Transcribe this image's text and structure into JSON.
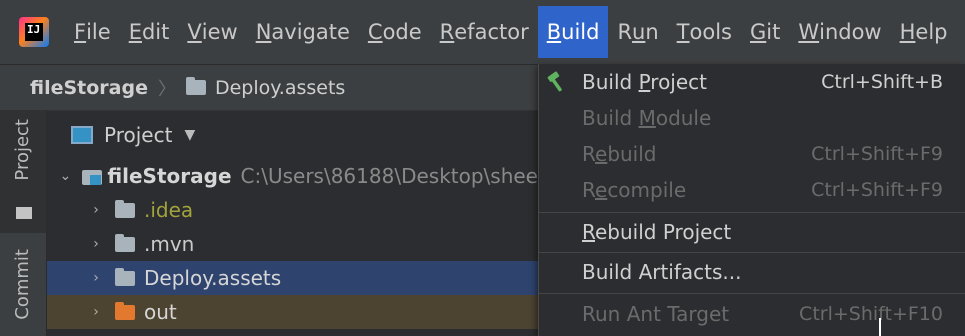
{
  "menubar": {
    "items": [
      {
        "label": "File",
        "underline": "F",
        "rest": "ile"
      },
      {
        "label": "Edit",
        "underline": "E",
        "rest": "dit"
      },
      {
        "label": "View",
        "underline": "V",
        "rest": "iew"
      },
      {
        "label": "Navigate",
        "underline": "N",
        "rest": "avigate"
      },
      {
        "label": "Code",
        "underline": "C",
        "rest": "ode"
      },
      {
        "label": "Refactor",
        "underline": "R",
        "rest": "efactor"
      },
      {
        "label": "Build",
        "underline": "B",
        "rest": "uild"
      },
      {
        "label": "Run",
        "pre": "R",
        "underline": "u",
        "rest": "n"
      },
      {
        "label": "Tools",
        "underline": "T",
        "rest": "ools"
      },
      {
        "label": "Git",
        "underline": "G",
        "rest": "it"
      },
      {
        "label": "Window",
        "underline": "W",
        "rest": "indow"
      },
      {
        "label": "Help",
        "underline": "H",
        "rest": "elp"
      }
    ]
  },
  "navbar": {
    "root": "fileStorage",
    "separator": "〉",
    "crumb": "Deploy.assets"
  },
  "sidestrip": {
    "project_label": "Project",
    "commit_label": "Commit"
  },
  "panel": {
    "header": "Project",
    "root": {
      "name": "fileStorage",
      "path": "C:\\Users\\86188\\Desktop\\shee"
    },
    "rows": [
      {
        "name": ".idea",
        "color": "#a3a33c"
      },
      {
        "name": ".mvn",
        "color": "#c9c9c9"
      },
      {
        "name": "Deploy.assets",
        "color": "#d6d6d6"
      },
      {
        "name": "out",
        "color": "#d6d6d6"
      }
    ]
  },
  "build_menu": {
    "build_project": {
      "pre": "Build ",
      "underline": "P",
      "rest": "roject",
      "shortcut": "Ctrl+Shift+B"
    },
    "build_module": {
      "pre": "Build ",
      "underline": "M",
      "rest": "odule"
    },
    "rebuild": {
      "pre": "R",
      "underline": "e",
      "rest": "build",
      "shortcut": "Ctrl+Shift+F9"
    },
    "recompile": {
      "pre": "R",
      "underline": "e",
      "rest": "compile",
      "shortcut": "Ctrl+Shift+F9"
    },
    "rebuild_project": {
      "underline": "R",
      "rest": "ebuild Project"
    },
    "build_artifacts": {
      "label": "Build Artifacts..."
    },
    "run_ant_target": {
      "label": "Run Ant Target",
      "shortcut": "Ctrl+Shift+F10"
    }
  },
  "colors": {
    "accent": "#2f65ca",
    "selection": "#2e436e",
    "excluded": "#4c4331",
    "hammer": "#5fb35f"
  }
}
